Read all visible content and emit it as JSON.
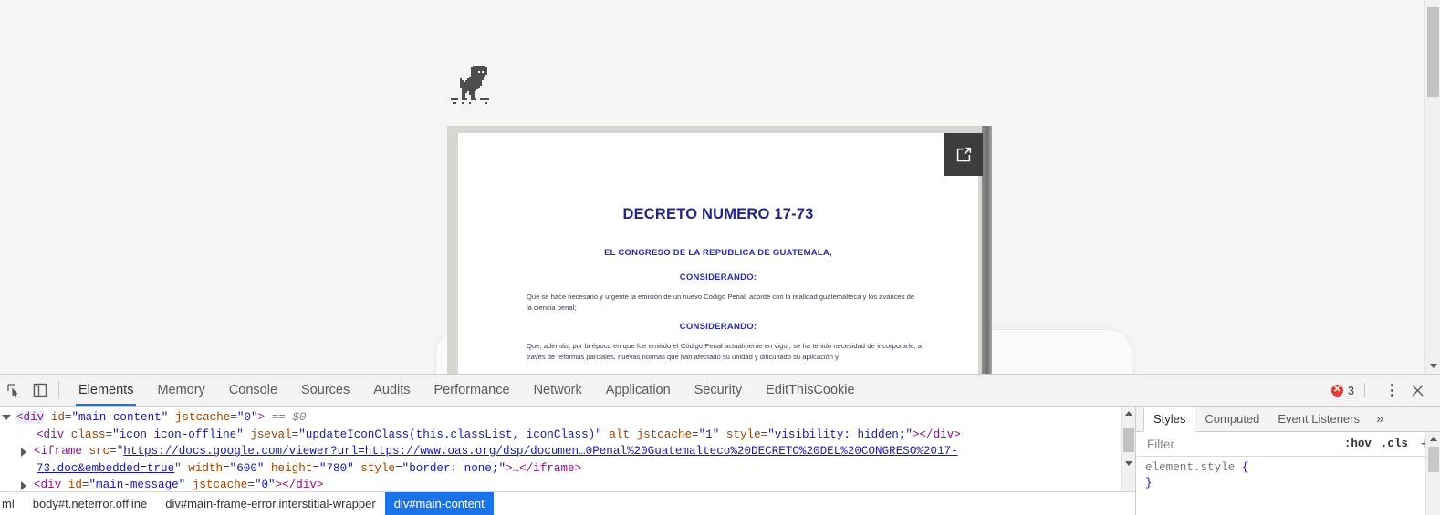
{
  "page": {
    "dino_icon": "chrome-offline-dinosaur-icon",
    "document_viewer": {
      "popout_icon": "open-in-new-window-icon",
      "title": "DECRETO NUMERO 17-73",
      "heading_congress": "EL CONGRESO DE LA REPUBLICA DE GUATEMALA,",
      "heading_considerando_1": "CONSIDERANDO:",
      "heading_considerando_2": "CONSIDERANDO:",
      "paragraph_1": "Que se hace necesario y urgente la emisión de un nuevo Código Penal, acorde con la realidad guatemalteca y los avances de la ciencia penal;",
      "paragraph_2": "Que, además, por la época en que fue emitido el Código Penal actualmente en vigor, se ha tenido necesidad de incorporarle, a través de reformas parciales, nuevas normas que han afectado su unidad y dificultado su aplicación y"
    }
  },
  "devtools": {
    "toolbar": {
      "inspect_icon": "inspect-element-icon",
      "device_icon": "toggle-device-toolbar-icon",
      "tabs": [
        {
          "label": "Elements",
          "active": true
        },
        {
          "label": "Memory",
          "active": false
        },
        {
          "label": "Console",
          "active": false
        },
        {
          "label": "Sources",
          "active": false
        },
        {
          "label": "Audits",
          "active": false
        },
        {
          "label": "Performance",
          "active": false
        },
        {
          "label": "Network",
          "active": false
        },
        {
          "label": "Application",
          "active": false
        },
        {
          "label": "Security",
          "active": false
        },
        {
          "label": "EditThisCookie",
          "active": false
        }
      ],
      "error_badge": {
        "icon": "error-circle-icon",
        "symbol": "✕",
        "count": "3"
      },
      "more_icon": "kebab-menu-icon",
      "close_icon": "close-icon"
    },
    "dom_tree": {
      "line1": {
        "twisty": "expanded-triangle-icon",
        "tag_open": "<div",
        "attr1_name": "id",
        "attr1_value": "\"main-content\"",
        "attr2_name": "jstcache",
        "attr2_value": "\"0\"",
        "tag_close": ">",
        "selection_marker": "== $0"
      },
      "line2": {
        "tag_open": "<div",
        "attr1_name": "class",
        "attr1_value": "\"icon icon-offline\"",
        "attr2_name": "jseval",
        "attr2_value": "\"updateIconClass(this.classList, iconClass)\"",
        "attr3_name": "alt",
        "attr4_name": "jstcache",
        "attr4_value": "\"1\"",
        "attr5_name": "style",
        "attr5_value": "\"visibility: hidden;\"",
        "tag_close": ">",
        "closing_tag": "</div>"
      },
      "line3": {
        "twisty": "collapsed-triangle-icon",
        "tag_open": "<iframe",
        "attr1_name": "src",
        "attr1_value_part1": "https://docs.google.com/viewer?url=https://www.oas.org/dsp/documen…0Penal%20Guatemalteco%20DECRETO%20DEL%20CONGRESO%2017-",
        "attr1_value_part2": "73.doc&embedded=true",
        "attr2_name": "width",
        "attr2_value": "\"600\"",
        "attr3_name": "height",
        "attr3_value": "\"780\"",
        "attr4_name": "style",
        "attr4_value": "\"border: none;\"",
        "tag_close": ">",
        "ellipsis": "…",
        "closing_tag": "</iframe>"
      },
      "line4": {
        "twisty": "collapsed-triangle-icon",
        "tag_open": "<div",
        "attr1_name": "id",
        "attr1_value": "\"main-message\"",
        "attr2_name": "jstcache",
        "attr2_value": "\"0\"",
        "tag_close": ">",
        "closing_tag": "</div>"
      }
    },
    "breadcrumb": [
      {
        "label": "ml",
        "active": false
      },
      {
        "label": "body#t.neterror.offline",
        "active": false
      },
      {
        "label": "div#main-frame-error.interstitial-wrapper",
        "active": false
      },
      {
        "label": "div#main-content",
        "active": true
      }
    ],
    "styles_pane": {
      "tabs": [
        {
          "label": "Styles",
          "active": true
        },
        {
          "label": "Computed",
          "active": false
        },
        {
          "label": "Event Listeners",
          "active": false
        }
      ],
      "more_tabs_icon": "chevron-double-right-icon",
      "filter_placeholder": "Filter",
      "hov_label": ":hov",
      "cls_label": ".cls",
      "new_rule_icon": "plus-icon",
      "rule_selector": "element.style",
      "rule_open_brace": "{",
      "rule_close_brace": "}"
    }
  },
  "colors": {
    "accent_blue": "#1a73e8",
    "error_red": "#e23b35",
    "tag_purple": "#881280",
    "attr_orange": "#994500",
    "value_blue": "#1a1aa6",
    "doc_title_navy": "#232383"
  }
}
